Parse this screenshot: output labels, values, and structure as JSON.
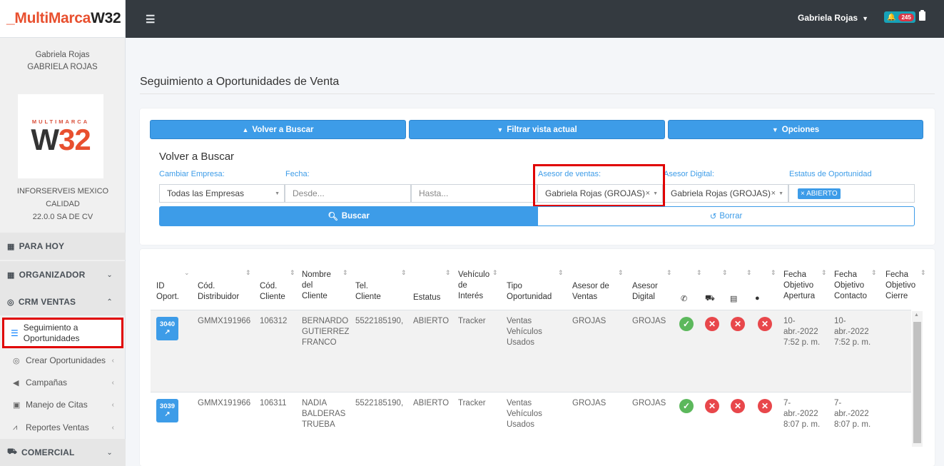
{
  "brand": {
    "part1": "_MultiMarca",
    "part2": "W32"
  },
  "topbar": {
    "user": "Gabriela Rojas",
    "notifications": "245"
  },
  "sidebar": {
    "user_name": "Gabriela Rojas",
    "user_code": "GABRIELA ROJAS",
    "logo_top": "MULTIMARCA",
    "logo_w": "W",
    "logo_num": "32",
    "company_line1": "INFORSERVEIS MEXICO CALIDAD",
    "company_line2": "22.0.0 SA DE CV",
    "para_hoy": "PARA HOY",
    "organizador": "ORGANIZADOR",
    "crm_ventas": "CRM VENTAS",
    "seguimiento_l1": "Seguimiento a",
    "seguimiento_l2": "Oportunidades",
    "crear": "Crear Oportunidades",
    "campanas": "Campañas",
    "citas": "Manejo de Citas",
    "reportes": "Reportes Ventas",
    "comercial": "COMERCIAL"
  },
  "page": {
    "title": "Seguimiento a Oportunidades de Venta"
  },
  "toolbar": {
    "volver": "Volver a Buscar",
    "filtrar": "Filtrar vista actual",
    "opciones": "Opciones"
  },
  "search": {
    "section_title": "Volver a Buscar",
    "empresa_label": "Cambiar Empresa:",
    "empresa_value": "Todas las Empresas",
    "fecha_label": "Fecha:",
    "desde_placeholder": "Desde...",
    "hasta_placeholder": "Hasta...",
    "asesor_label": "Asesor de ventas:",
    "asesor_value": "Gabriela Rojas (GROJAS)",
    "digital_label": "Asesor Digital:",
    "digital_value": "Gabriela Rojas (GROJAS)",
    "estatus_label": "Estatus de Oportunidad",
    "estatus_tag": "× ABIERTO",
    "buscar": "Buscar",
    "borrar": "Borrar"
  },
  "table": {
    "headers": {
      "id": [
        "ID",
        "Oport."
      ],
      "distribuidor": [
        "Cód.",
        "Distribuidor"
      ],
      "cliente": [
        "Cód.",
        "Cliente"
      ],
      "nombre": [
        "Nombre",
        "del",
        "Cliente"
      ],
      "tel": [
        "Tel.",
        "Cliente"
      ],
      "estatus": [
        "Estatus"
      ],
      "vehiculo": [
        "Vehículo",
        "de",
        "Interés"
      ],
      "tipo": [
        "Tipo",
        "Oportunidad"
      ],
      "asesor_ventas": [
        "Asesor de",
        "Ventas"
      ],
      "asesor_digital": [
        "Asesor",
        "Digital"
      ],
      "apertura": [
        "Fecha",
        "Objetivo",
        "Apertura"
      ],
      "contacto": [
        "Fecha",
        "Objetivo",
        "Contacto"
      ],
      "cierre": [
        "Fecha",
        "Objetivo",
        "Cierre"
      ]
    },
    "rows": [
      {
        "id": "3040",
        "distribuidor": "GMMX191966",
        "cliente": "106312",
        "nombre": [
          "BERNARDO",
          "GUTIERREZ",
          "FRANCO"
        ],
        "tel": "5522185190,",
        "estatus": "ABIERTO",
        "vehiculo": "Tracker",
        "tipo": [
          "Ventas",
          "Vehículos",
          "Usados"
        ],
        "asesor_ventas": "GROJAS",
        "asesor_digital": "GROJAS",
        "apertura": [
          "10-",
          "abr.-2022",
          "7:52 p. m."
        ],
        "contacto": [
          "10-",
          "abr.-2022",
          "7:52 p. m."
        ]
      },
      {
        "id": "3039",
        "distribuidor": "GMMX191966",
        "cliente": "106311",
        "nombre": [
          "NADIA",
          "BALDERAS",
          "TRUEBA"
        ],
        "tel": "5522185190,",
        "estatus": "ABIERTO",
        "vehiculo": "Tracker",
        "tipo": [
          "Ventas",
          "Vehículos",
          "Usados"
        ],
        "asesor_ventas": "GROJAS",
        "asesor_digital": "GROJAS",
        "apertura": [
          "7-",
          "abr.-2022",
          "8:07 p. m."
        ],
        "contacto": [
          "7-",
          "abr.-2022",
          "8:07 p. m."
        ]
      }
    ]
  },
  "colors": {
    "accent": "#3d9ce8",
    "highlight": "#e00000",
    "ok": "#5cb85c",
    "error": "#e8474b",
    "topbar": "#343a40"
  }
}
